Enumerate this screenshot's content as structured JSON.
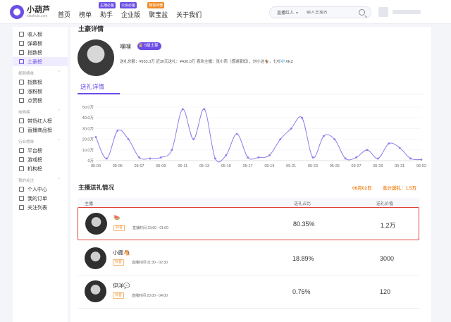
{
  "brand": {
    "name": "小葫芦",
    "url": "xiaohulu.com"
  },
  "nav": {
    "items": [
      {
        "label": "首页",
        "badge": ""
      },
      {
        "label": "榜单",
        "badge": ""
      },
      {
        "label": "助手",
        "badge": "主播必备"
      },
      {
        "label": "企业版",
        "badge": "公会必备"
      },
      {
        "label": "聚宝盆",
        "badge": "赚钱神器"
      },
      {
        "label": "关于我们",
        "badge": ""
      }
    ]
  },
  "search": {
    "category": "直播红人",
    "placeholder": "输入主播名"
  },
  "sidebar": {
    "top_items": [
      "收入榜",
      "弹幕榜",
      "指数榜",
      "土豪榜"
    ],
    "groups": [
      {
        "label": "视频榜单",
        "items": [
          "指数榜",
          "涨粉榜",
          "点赞榜"
        ]
      },
      {
        "label": "电商榜",
        "items": [
          "带货红人榜",
          "直播商品榜"
        ]
      },
      {
        "label": "行业榜单",
        "items": [
          "平台榜",
          "游戏榜",
          "机构榜"
        ]
      },
      {
        "label": "我的关注",
        "items": [
          "个人中心",
          "我的订单",
          "关注列表"
        ]
      }
    ],
    "active": "土豪榜"
  },
  "profile": {
    "section_title": "土豪详情",
    "name": "嘿嘿",
    "badge": "5级土豪",
    "stats": "送礼总额：¥933.3万   近30天送礼：¥430.0万   喜欢主播：张小莉（感谢家妈），刘小洁🐐，七杉💎XKZ"
  },
  "tab": {
    "label": "送礼详情"
  },
  "chart_data": {
    "type": "line",
    "x": [
      "05-03",
      "05-04",
      "05-05",
      "05-06",
      "05-07",
      "05-08",
      "05-09",
      "05-10",
      "05-11",
      "05-12",
      "05-13",
      "05-14",
      "05-15",
      "05-16",
      "05-17",
      "05-18",
      "05-19",
      "05-20",
      "05-21",
      "05-22",
      "05-23",
      "05-24",
      "05-25",
      "05-26",
      "05-27",
      "05-28",
      "05-29",
      "05-30",
      "05-31",
      "06-01",
      "06-02"
    ],
    "x_ticks": [
      "05-03",
      "05-05",
      "05-07",
      "05-09",
      "05-11",
      "05-13",
      "05-15",
      "05-17",
      "05-19",
      "05-21",
      "05-23",
      "05-25",
      "05-27",
      "05-29",
      "05-31",
      "06-02"
    ],
    "series": [
      {
        "values": [
          22,
          2,
          28,
          20,
          3,
          2,
          3,
          10,
          48,
          20,
          48,
          2,
          5,
          25,
          3,
          3,
          5,
          20,
          30,
          40,
          3,
          23,
          20,
          2,
          3,
          10,
          2,
          16,
          12,
          2,
          1
        ]
      }
    ],
    "ylim": [
      0,
      50
    ],
    "y_ticks": [
      "0万",
      "10.0万",
      "20.0万",
      "30.0万",
      "40.0万",
      "50.0万"
    ],
    "color": "#8e7ce8"
  },
  "ranking": {
    "title": "主播送礼情况",
    "date": "06月02日",
    "total": "总计送礼：1.5万",
    "columns": [
      "主播",
      "送礼占比",
      "送礼价值"
    ],
    "rows": [
      {
        "name": "🍉",
        "platform": "抖音",
        "time": "直播时间 23:00 - 01:00",
        "share": "80.35%",
        "value": "1.2万",
        "highlight": true
      },
      {
        "name": "小鹿🐴",
        "platform": "抖音",
        "time": "直播时间 01:30 - 02:30",
        "share": "18.89%",
        "value": "3000",
        "highlight": false
      },
      {
        "name": "伊洋💬",
        "platform": "抖音",
        "time": "直播时间 23:00 - 04:00",
        "share": "0.76%",
        "value": "120",
        "highlight": false
      }
    ]
  }
}
